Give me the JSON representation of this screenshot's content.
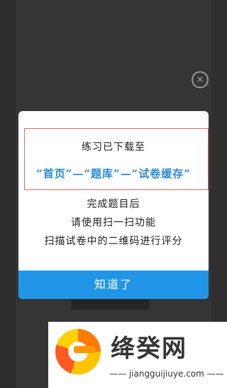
{
  "dialog": {
    "line1": "练习已下载至",
    "line2": "“首页”—“题库”—“试卷缓存”",
    "line3": "完成题目后",
    "line4": "请使用扫一扫功能",
    "line5": "扫描试卷中的二维码进行评分",
    "ok_label": "知道了"
  },
  "watermark": {
    "title": "绛癸网",
    "url": "—— jiangguijiuye.com ——"
  },
  "colors": {
    "accent": "#2196e8",
    "highlight_text": "#2a8bd4",
    "highlight_border": "#e36b6b"
  },
  "icons": {
    "close": "close-circle-icon"
  }
}
